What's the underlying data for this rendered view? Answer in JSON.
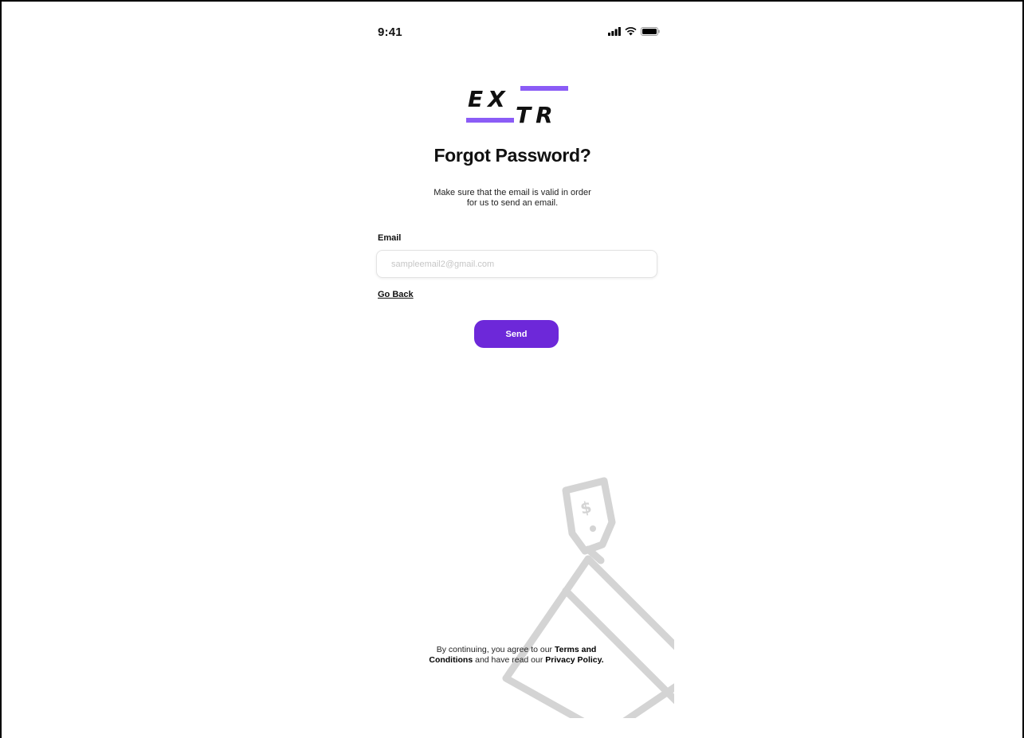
{
  "status_bar": {
    "time": "9:41",
    "icons": [
      "signal-icon",
      "wifi-icon",
      "battery-icon"
    ]
  },
  "logo": {
    "line1": "EX",
    "line2": "TR",
    "accent_color": "#8b5cf6"
  },
  "header": {
    "title": "Forgot Password?",
    "subtitle_line1": "Make sure that the email is valid in order",
    "subtitle_line2": "for us to send an email."
  },
  "form": {
    "email_label": "Email",
    "email_placeholder": "sampleemail2@gmail.com",
    "email_value": "",
    "go_back_label": "Go Back",
    "send_label": "Send",
    "send_color": "#6d28d9"
  },
  "legal": {
    "prefix": "By continuing, you agree to our ",
    "terms": "Terms and Conditions",
    "middle": " and have read our ",
    "privacy": "Privacy Policy."
  },
  "illustration": {
    "icon": "price-tag-card-icon"
  }
}
